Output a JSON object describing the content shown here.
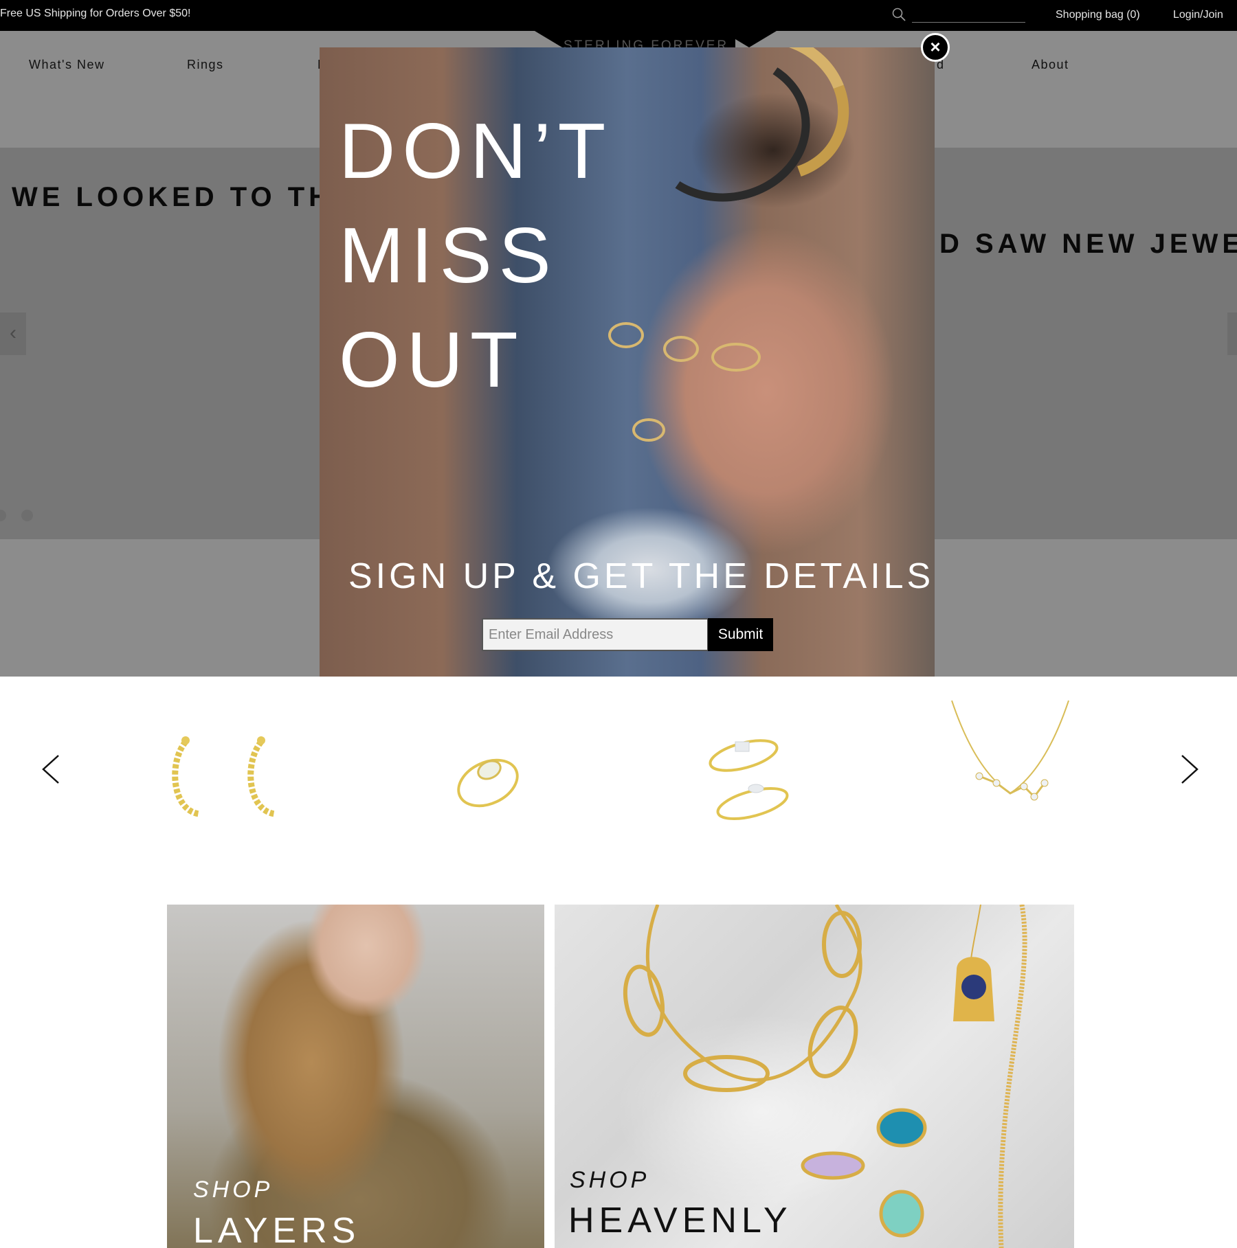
{
  "topbar": {
    "promo": "Free US Shipping for Orders Over $50!",
    "search_placeholder": "",
    "shopping_bag": "Shopping bag (0)",
    "login": "Login/Join"
  },
  "logo": {
    "text": "STERLING FOREVER"
  },
  "nav": {
    "items": [
      "What's New",
      "Rings",
      "D",
      "d",
      "About"
    ]
  },
  "hero": {
    "line1": "WE LOOKED TO THE",
    "line2": "D SAW NEW JEWELS",
    "prev_icon": "chevron-left-icon",
    "slide_count": 2,
    "active_slide": 1
  },
  "modal": {
    "headline_1": "DON’T",
    "headline_2": "MISS",
    "headline_3": "OUT",
    "signup": "SIGN UP & GET THE DETAILS",
    "email_placeholder": "Enter Email Address",
    "submit": "Submit",
    "close_icon": "close-icon"
  },
  "carousel": {
    "prev_icon": "chevron-left-icon",
    "next_icon": "chevron-right-icon",
    "products": [
      {
        "name": "twisted-hoop-earrings",
        "color": "#e5c95a"
      },
      {
        "name": "opal-ring",
        "color": "#e5c95a"
      },
      {
        "name": "stacking-rings",
        "color": "#e5c95a"
      },
      {
        "name": "constellation-necklace",
        "color": "#e5c95a"
      }
    ]
  },
  "tiles": {
    "layers": {
      "shop": "SHOP",
      "title": "LAYERS"
    },
    "heavenly": {
      "shop": "SHOP",
      "title": "HEAVENLY"
    }
  },
  "colors": {
    "gold": "#e5c95a",
    "black": "#000000",
    "overlay": "rgba(0,0,0,0.45)"
  }
}
